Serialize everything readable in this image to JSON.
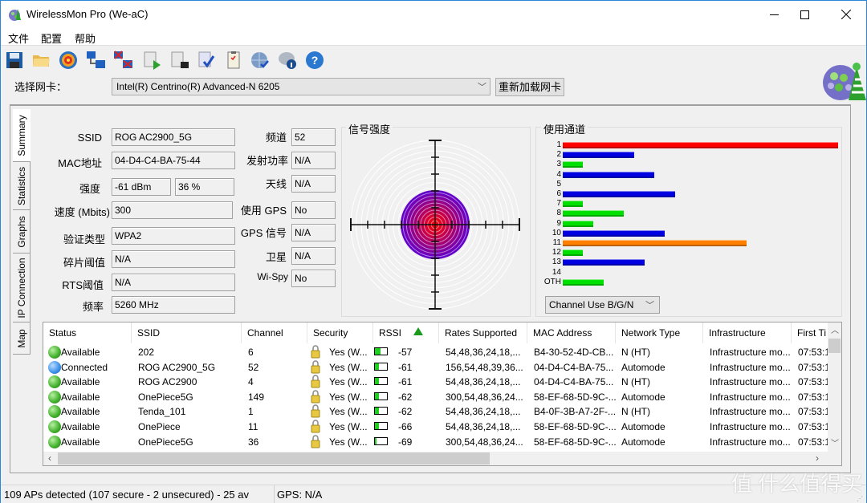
{
  "window": {
    "title": "WirelessMon Pro (We-aC)"
  },
  "menu": [
    "文件",
    "配置",
    "帮助"
  ],
  "toolbar": {
    "icons": [
      "save-icon",
      "open-folder-icon",
      "target-icon",
      "connect-icon",
      "disconnect-icon",
      "start-log-icon",
      "stop-log-icon",
      "report-icon",
      "clipboard-icon",
      "web-icon",
      "info-icon",
      "help-icon"
    ]
  },
  "adapter": {
    "label": "选择网卡：",
    "selected": "Intel(R) Centrino(R) Advanced-N 6205",
    "reload_label": "重新加载网卡"
  },
  "tabs": [
    "Summary",
    "Statistics",
    "Graphs",
    "IP Connection",
    "Map"
  ],
  "summary": {
    "ssid_label": "SSID",
    "ssid": "ROG  AC2900_5G",
    "mac_label": "MAC地址",
    "mac": "04-D4-C4-BA-75-44",
    "strength_label": "强度",
    "strength_dbm": "-61 dBm",
    "strength_pct": "36 %",
    "speed_label": "速度 (Mbits)",
    "speed": "300",
    "auth_label": "验证类型",
    "auth": "WPA2",
    "frag_label": "碎片阈值",
    "frag": "N/A",
    "rts_label": "RTS阈值",
    "rts": "N/A",
    "freq_label": "频率",
    "freq": "5260 MHz",
    "channel_label": "频道",
    "channel": "52",
    "txpower_label": "发射功率",
    "txpower": "N/A",
    "antenna_label": "天线",
    "antenna": "N/A",
    "use_gps_label": "使用 GPS",
    "use_gps": "No",
    "gps_signal_label": "GPS 信号",
    "gps_signal": "N/A",
    "satellite_label": "卫星",
    "satellite": "N/A",
    "wispy_label": "Wi-Spy",
    "wispy": "No"
  },
  "signal_panel": {
    "title": "信号强度",
    "strength_percent": 36
  },
  "channel_panel": {
    "title": "使用通道",
    "select_value": "Channel Use B/G/N"
  },
  "chart_data": {
    "type": "bar",
    "title": "使用通道",
    "categories": [
      "1",
      "2",
      "3",
      "4",
      "5",
      "6",
      "7",
      "8",
      "9",
      "10",
      "11",
      "12",
      "13",
      "14",
      "OTH"
    ],
    "values": [
      27,
      7,
      2,
      9,
      0,
      11,
      2,
      6,
      3,
      10,
      18,
      2,
      8,
      0,
      4
    ],
    "colors": [
      "#ff0000",
      "#0000e0",
      "#00e000",
      "#0000e0",
      "#00e000",
      "#0000e0",
      "#00e000",
      "#00e000",
      "#00e000",
      "#0000e0",
      "#ff8000",
      "#00e000",
      "#0000e0",
      "#00e000",
      "#00e000"
    ],
    "orientation": "horizontal",
    "xlim": [
      0,
      27
    ]
  },
  "table": {
    "columns": [
      "Status",
      "SSID",
      "Channel",
      "Security",
      "RSSI",
      "Rates Supported",
      "MAC Address",
      "Network Type",
      "Infrastructure",
      "First Ti"
    ],
    "rows": [
      {
        "status": "Available",
        "state": "green",
        "ssid": "202",
        "channel": "6",
        "security": "Yes (W...",
        "rssi": "-57",
        "rssi_level": 0.45,
        "rates": "54,48,36,24,18,...",
        "mac": "B4-30-52-4D-CB...",
        "type": "N (HT)",
        "infra": "Infrastructure mo...",
        "first": "07:53:1"
      },
      {
        "status": "Connected",
        "state": "blue",
        "ssid": "ROG  AC2900_5G",
        "channel": "52",
        "security": "Yes (W...",
        "rssi": "-61",
        "rssi_level": 0.35,
        "rates": "156,54,48,39,36...",
        "mac": "04-D4-C4-BA-75...",
        "type": "Automode",
        "infra": "Infrastructure mo...",
        "first": "07:53:1"
      },
      {
        "status": "Available",
        "state": "green",
        "ssid": "ROG  AC2900",
        "channel": "4",
        "security": "Yes (W...",
        "rssi": "-61",
        "rssi_level": 0.35,
        "rates": "54,48,36,24,18,...",
        "mac": "04-D4-C4-BA-75...",
        "type": "N (HT)",
        "infra": "Infrastructure mo...",
        "first": "07:53:1"
      },
      {
        "status": "Available",
        "state": "green",
        "ssid": "OnePiece5G",
        "channel": "149",
        "security": "Yes (W...",
        "rssi": "-62",
        "rssi_level": 0.35,
        "rates": "300,54,48,36,24...",
        "mac": "58-EF-68-5D-9C-...",
        "type": "Automode",
        "infra": "Infrastructure mo...",
        "first": "07:53:1"
      },
      {
        "status": "Available",
        "state": "green",
        "ssid": "Tenda_101",
        "channel": "1",
        "security": "Yes (W...",
        "rssi": "-62",
        "rssi_level": 0.35,
        "rates": "54,48,36,24,18,...",
        "mac": "B4-0F-3B-A7-2F-...",
        "type": "N (HT)",
        "infra": "Infrastructure mo...",
        "first": "07:53:1"
      },
      {
        "status": "Available",
        "state": "green",
        "ssid": "OnePiece",
        "channel": "11",
        "security": "Yes (W...",
        "rssi": "-66",
        "rssi_level": 0.3,
        "rates": "54,48,36,24,18,...",
        "mac": "58-EF-68-5D-9C-...",
        "type": "Automode",
        "infra": "Infrastructure mo...",
        "first": "07:53:1"
      },
      {
        "status": "Available",
        "state": "green",
        "ssid": "OnePiece5G",
        "channel": "36",
        "security": "Yes (W...",
        "rssi": "-69",
        "rssi_level": 0.15,
        "rates": "300,54,48,36,24...",
        "mac": "58-EF-68-5D-9C-...",
        "type": "Automode",
        "infra": "Infrastructure mo...",
        "first": "07:53:1"
      }
    ]
  },
  "status": {
    "aps": "109 APs detected (107 secure - 2 unsecured) - 25 av",
    "gps": "GPS: N/A"
  },
  "watermark": "值 什么值得买"
}
